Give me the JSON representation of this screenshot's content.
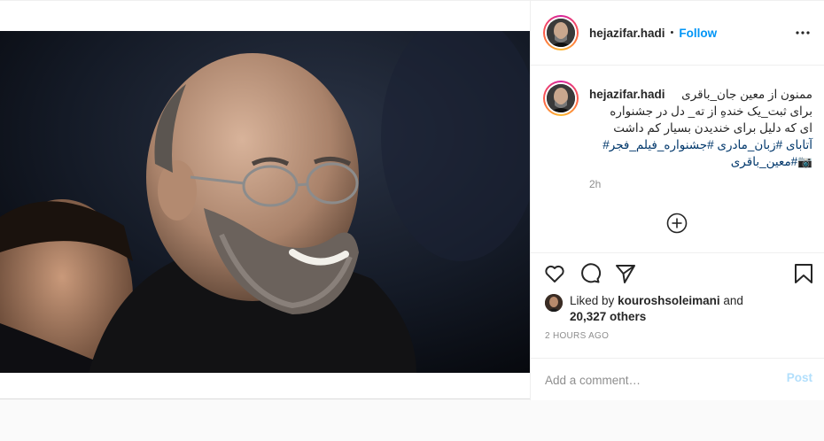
{
  "post": {
    "username": "hejazifar.hadi",
    "follow_label": "Follow",
    "dot": "•",
    "caption_line1": "ممنون از معین جان_باقری",
    "caption_line2": "برای ثبت_یک خندهِ از ته_ دل در جشنواره",
    "caption_line3": "ای که دلیل برای خندیدن بسیار کم داشت",
    "caption_line4": "آتابای #زبان_مادری #جشنواره_فیلم_فجر#",
    "caption_line5": "📷#معین_باقری",
    "caption_age": "2h",
    "liked_by_prefix": "Liked by",
    "liked_by_user": "kouroshsoleimani",
    "liked_by_and": "and",
    "likes_others": "20,327 others",
    "timestamp": "2 HOURS AGO",
    "comment_placeholder": "Add a comment…",
    "post_label": "Post"
  },
  "icons": {
    "more": "more-options-icon",
    "load_more": "plus-circle-icon",
    "like": "heart-icon",
    "comment": "comment-icon",
    "share": "send-icon",
    "save": "bookmark-icon"
  },
  "colors": {
    "link": "#0095f6",
    "hashtag": "#00376b",
    "muted": "#8e8e8e",
    "post_disabled": "#b2dffc"
  }
}
